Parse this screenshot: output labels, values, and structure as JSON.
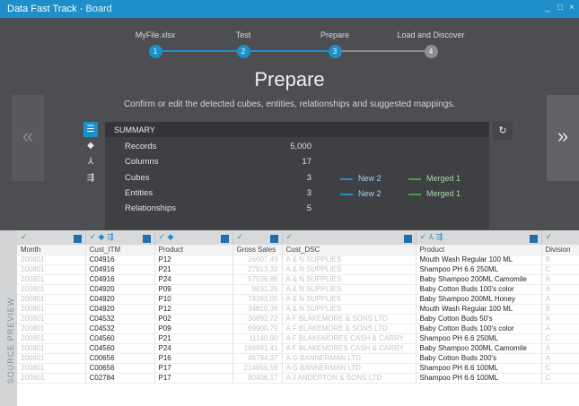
{
  "window": {
    "title": "Data Fast Track",
    "subtitle": "Board",
    "separator": " - "
  },
  "window_controls": {
    "minimize": "_",
    "maximize": "□",
    "close": "×"
  },
  "nav": {
    "prev": "«",
    "next": "»"
  },
  "stepper": {
    "steps": [
      {
        "label": "MyFile.xlsx",
        "number": "1"
      },
      {
        "label": "Test",
        "number": "2"
      },
      {
        "label": "Prepare",
        "number": "3"
      },
      {
        "label": "Load and Discover",
        "number": "4"
      }
    ],
    "current": 3
  },
  "page": {
    "title": "Prepare",
    "subtitle": "Confirm or edit the detected cubes, entities, relationships and suggested mappings."
  },
  "side_tabs": [
    "list-icon",
    "cube-icon",
    "hierarchy-icon",
    "relationship-icon"
  ],
  "summary": {
    "header": "SUMMARY",
    "rows": [
      {
        "label": "Records",
        "value": "5,000"
      },
      {
        "label": "Columns",
        "value": "17"
      },
      {
        "label": "Cubes",
        "value": "3"
      },
      {
        "label": "Entities",
        "value": "3"
      },
      {
        "label": "Relationships",
        "value": "5"
      }
    ],
    "cubes_new": "New  2",
    "cubes_merged": "Merged  1",
    "entities_new": "New  2",
    "entities_merged": "Merged  1"
  },
  "refresh_icon": "↻",
  "preview_label": "SOURCE PREVIEW",
  "colors": {
    "accent": "#1e90c9",
    "merged": "#3caa3c",
    "panel": "#4d4e51"
  },
  "grid": {
    "headers": [
      "Month",
      "Cust_ITM",
      "Product",
      "Gross Sales",
      "Cust_DSC",
      "Product",
      "Division"
    ],
    "rows": [
      [
        "200801",
        "C04916",
        "P12",
        "26607,49",
        "A & N SUPPLIES",
        "Mouth Wash Regular 100 ML",
        "B"
      ],
      [
        "200801",
        "C04916",
        "P21",
        "27913,33",
        "A & N SUPPLIES",
        "Shampoo PH 6.6 250ML",
        "C"
      ],
      [
        "200801",
        "C04916",
        "P24",
        "57036,86",
        "A & N SUPPLIES",
        "Baby Shampoo 200ML Camomile",
        "A"
      ],
      [
        "200801",
        "C04920",
        "P09",
        "9831,25",
        "A & N SUPPLIES",
        "Baby Cotton Buds 100's color",
        "A"
      ],
      [
        "200801",
        "C04920",
        "P10",
        "74393,05",
        "A & N SUPPLIES",
        "Baby Shampoo 200ML Honey",
        "A"
      ],
      [
        "200801",
        "C04920",
        "P12",
        "34810,39",
        "A & N SUPPLIES",
        "Mouth Wash Regular 100 ML",
        "B"
      ],
      [
        "200801",
        "C04532",
        "P02",
        "36892,72",
        "A F BLAKEMORE & SONS LTD",
        "Baby Cotton Buds  50's",
        "A"
      ],
      [
        "200801",
        "C04532",
        "P09",
        "69900,79",
        "A F BLAKEMORE & SONS LTD",
        "Baby Cotton Buds 100's color",
        "A"
      ],
      [
        "200801",
        "C04560",
        "P21",
        "11140,90",
        "A F BLAKEMORES CASH & CARRY",
        "Shampoo PH 6.6 250ML",
        "C"
      ],
      [
        "200801",
        "C04560",
        "P24",
        "166981,41",
        "A F BLAKEMORES CASH & CARRY",
        "Baby Shampoo 200ML Camomile",
        "A"
      ],
      [
        "200801",
        "C00656",
        "P16",
        "46794,37",
        "A G BANNERMAN LTD",
        "Baby Cotton Buds 200's",
        "A"
      ],
      [
        "200801",
        "C00656",
        "P17",
        "214656,59",
        "A G BANNERMAN LTD",
        "Shampoo PH 6.6 100ML",
        "C"
      ],
      [
        "200801",
        "C02784",
        "P17",
        "80406,17",
        "A J ANDERTON & SONS LTD",
        "Shampoo PH 6.6 100ML",
        "C"
      ]
    ]
  }
}
